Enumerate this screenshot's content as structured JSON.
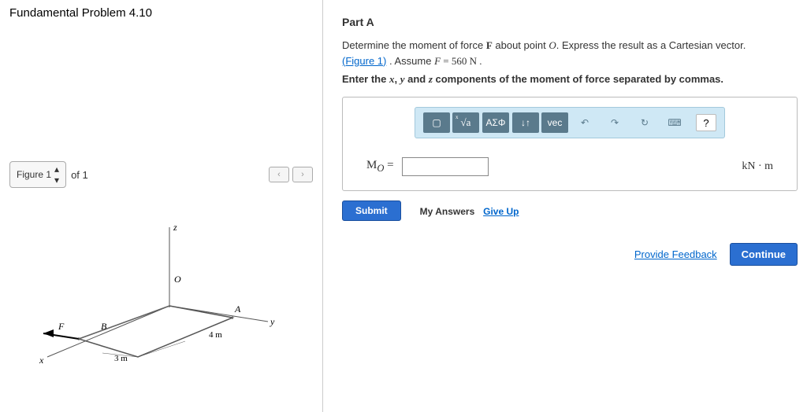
{
  "problem_title": "Fundamental Problem 4.10",
  "figure": {
    "label": "Figure 1",
    "of_text": "of 1",
    "prev": "‹",
    "next": "›",
    "labels": {
      "z": "z",
      "y": "y",
      "x": "x",
      "O": "O",
      "A": "A",
      "B": "B",
      "F": "F",
      "dim1": "4 m",
      "dim2": "3 m"
    }
  },
  "part": {
    "title": "Part A",
    "instruction_pre": "Determine the moment of force ",
    "instruction_F": "F",
    "instruction_mid": " about point ",
    "instruction_O": "O",
    "instruction_post": ". Express the result as a Cartesian vector. ",
    "figure_link": "(Figure 1)",
    "assume_pre": " . Assume ",
    "assume_F": "F",
    "assume_eq": " = 560 N .",
    "enter_pre": "Enter the ",
    "enter_x": "x",
    "enter_mid1": ", ",
    "enter_y": "y",
    "enter_mid2": " and ",
    "enter_z": "z",
    "enter_post": " components of the moment of force separated by commas."
  },
  "toolbar": {
    "template": "▢",
    "xscript": "x√a",
    "greek": "ΑΣΦ",
    "vec_arrows": "↓↑",
    "vec": "vec",
    "undo": "↶",
    "redo": "↷",
    "reset": "↻",
    "keyboard": "⌨",
    "help": "?"
  },
  "answer": {
    "label_var": "M",
    "label_sub": "O",
    "equals": " = ",
    "input_value": "",
    "unit": "kN · m"
  },
  "buttons": {
    "submit": "Submit",
    "my_answers": "My Answers",
    "give_up": "Give Up",
    "feedback": "Provide Feedback",
    "continue": "Continue"
  }
}
